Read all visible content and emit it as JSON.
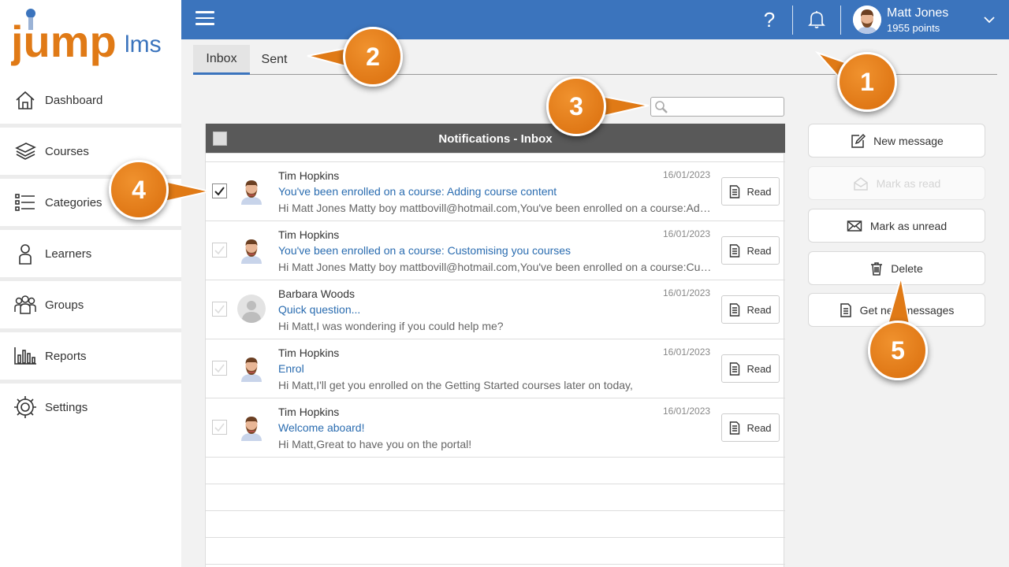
{
  "brand": {
    "logo_main": "jump",
    "logo_sub": "lms",
    "accent": "#3b74bd",
    "orange": "#e07a16"
  },
  "sidebar": {
    "items": [
      {
        "label": "Dashboard",
        "icon": "home-icon"
      },
      {
        "label": "Courses",
        "icon": "book-stack-icon"
      },
      {
        "label": "Categories",
        "icon": "list-icon"
      },
      {
        "label": "Learners",
        "icon": "person-icon"
      },
      {
        "label": "Groups",
        "icon": "group-icon"
      },
      {
        "label": "Reports",
        "icon": "bar-chart-icon"
      },
      {
        "label": "Settings",
        "icon": "gear-icon"
      }
    ]
  },
  "header": {
    "user_name": "Matt Jones",
    "user_points": "1955 points",
    "help_glyph": "?"
  },
  "tabs": [
    {
      "label": "Inbox",
      "active": true
    },
    {
      "label": "Sent",
      "active": false
    }
  ],
  "search": {
    "placeholder": "",
    "value": ""
  },
  "table": {
    "title": "Notifications - Inbox",
    "read_label": "Read",
    "rows": [
      {
        "sender": "Tim Hopkins",
        "date": "16/01/2023",
        "subject": "You've been enrolled on a course: Adding course content",
        "preview": "Hi Matt Jones Matty boy mattbovill@hotmail.com,You've been enrolled on a course:Adding course content",
        "checked": true,
        "avatar": "male-avatar"
      },
      {
        "sender": "Tim Hopkins",
        "date": "16/01/2023",
        "subject": "You've been enrolled on a course: Customising you courses",
        "preview": "Hi Matt Jones Matty boy mattbovill@hotmail.com,You've been enrolled on a course:Customising you courses",
        "checked": false,
        "avatar": "male-avatar"
      },
      {
        "sender": "Barbara Woods",
        "date": "16/01/2023",
        "subject": "Quick question...",
        "preview": "Hi Matt,I was wondering if you could help me?",
        "checked": false,
        "avatar": "blank-avatar"
      },
      {
        "sender": "Tim Hopkins",
        "date": "16/01/2023",
        "subject": "Enrol",
        "preview": "Hi Matt,I'll get you enrolled on the Getting Started courses later on today,",
        "checked": false,
        "avatar": "male-avatar"
      },
      {
        "sender": "Tim Hopkins",
        "date": "16/01/2023",
        "subject": "Welcome aboard!",
        "preview": "Hi Matt,Great to have you on the portal!",
        "checked": false,
        "avatar": "male-avatar"
      }
    ]
  },
  "actions": {
    "new_message": "New message",
    "mark_as_read": "Mark as read",
    "mark_as_unread": "Mark as unread",
    "delete": "Delete",
    "get_new_messages": "Get new messages"
  },
  "callouts": [
    "1",
    "2",
    "3",
    "4",
    "5"
  ]
}
